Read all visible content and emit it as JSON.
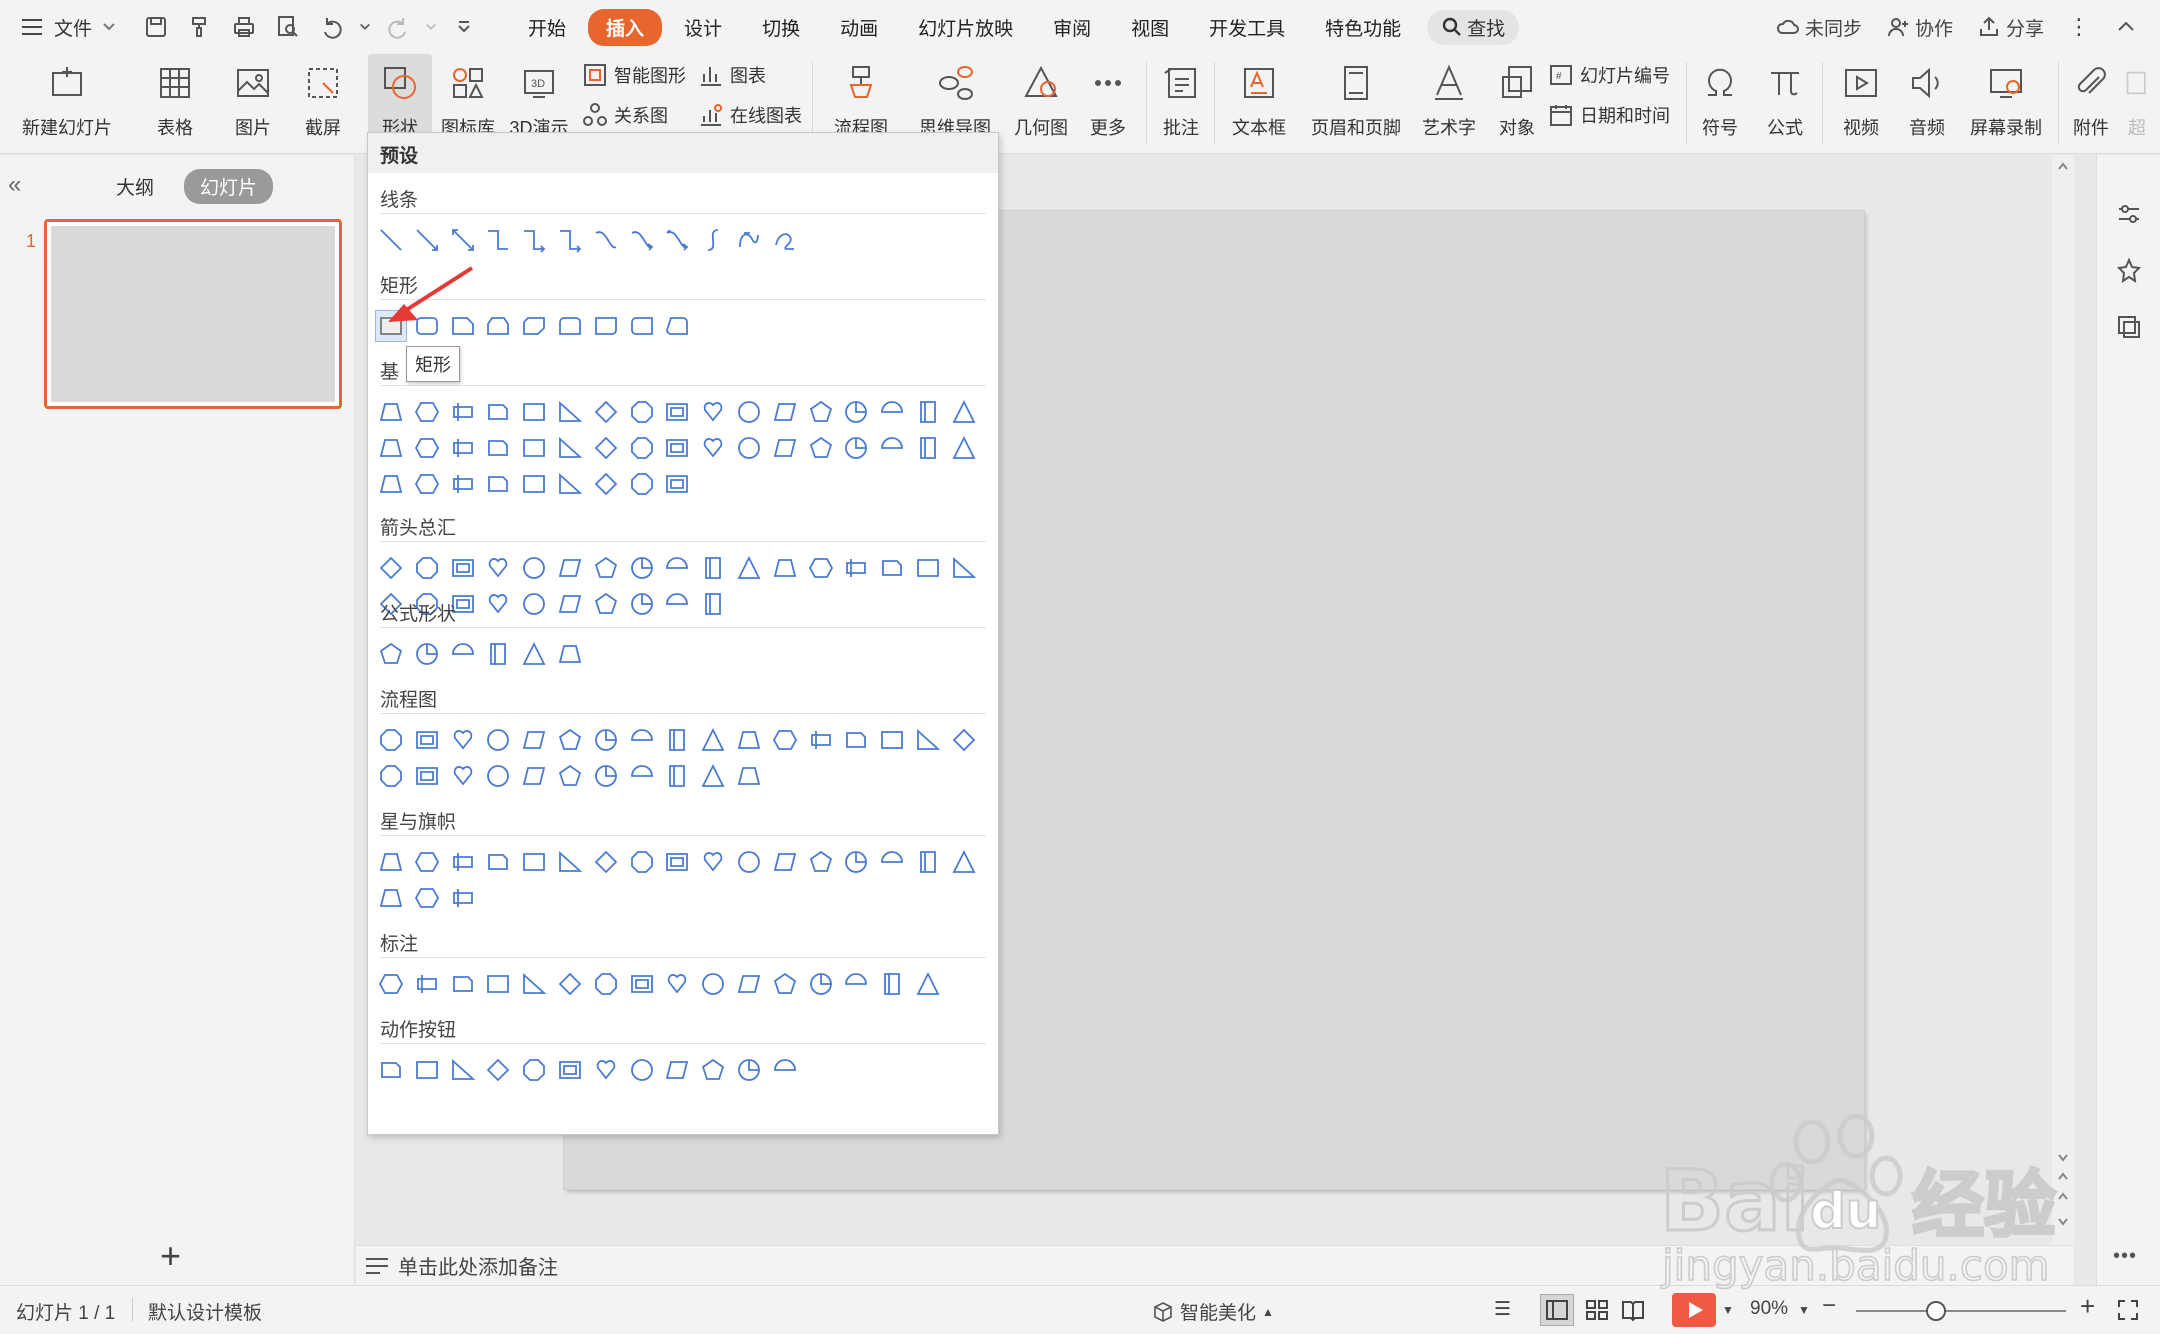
{
  "menubar": {
    "file_label": "文件",
    "tabs": [
      {
        "label": "开始",
        "active": false
      },
      {
        "label": "插入",
        "active": true
      },
      {
        "label": "设计",
        "active": false
      },
      {
        "label": "切换",
        "active": false
      },
      {
        "label": "动画",
        "active": false
      },
      {
        "label": "幻灯片放映",
        "active": false
      },
      {
        "label": "审阅",
        "active": false
      },
      {
        "label": "视图",
        "active": false
      },
      {
        "label": "开发工具",
        "active": false
      },
      {
        "label": "特色功能",
        "active": false
      }
    ],
    "search_label": "查找",
    "sync_label": "未同步",
    "collab_label": "协作",
    "share_label": "分享",
    "accent_color": "#e8662d"
  },
  "ribbon": {
    "new_slide": "新建幻灯片",
    "table": "表格",
    "picture": "图片",
    "screenshot": "截屏",
    "shape": "形状",
    "icon_lib": "图标库",
    "demo_3d": "3D演示",
    "smart_shape": "智能图形",
    "chart": "图表",
    "relation": "关系图",
    "online_chart": "在线图表",
    "flowchart": "流程图",
    "mindmap": "思维导图",
    "geometry": "几何图",
    "more": "更多",
    "comment": "批注",
    "textbox": "文本框",
    "header_footer": "页眉和页脚",
    "wordart": "艺术字",
    "object": "对象",
    "slide_number": "幻灯片编号",
    "date_time": "日期和时间",
    "symbol": "符号",
    "formula": "公式",
    "video": "视频",
    "audio": "音频",
    "screen_record": "屏幕录制",
    "attachment": "附件",
    "overflow": "超"
  },
  "left_panel": {
    "tabs": [
      {
        "label": "大纲",
        "active": false
      },
      {
        "label": "幻灯片",
        "active": true
      }
    ],
    "slide_number": "1"
  },
  "shapes_panel": {
    "header": "预设",
    "sections": [
      {
        "title": "线条"
      },
      {
        "title": "矩形"
      },
      {
        "title": "基"
      },
      {
        "title": "箭头总汇"
      },
      {
        "title": "公式形状"
      },
      {
        "title": "流程图"
      },
      {
        "title": "星与旗帜"
      },
      {
        "title": "标注"
      },
      {
        "title": "动作按钮"
      }
    ],
    "tooltip": "矩形",
    "icon_color": "#4a7bd0"
  },
  "notes": {
    "placeholder": "单击此处添加备注"
  },
  "statusbar": {
    "slide_count": "幻灯片 1 / 1",
    "template": "默认设计模板",
    "smart_beautify": "智能美化",
    "zoom": "90%",
    "zoom_level": 0.38
  },
  "watermark": {
    "text_1": "Bai",
    "text_2": "du",
    "text_3": "经验",
    "url": "jingyan.baidu.com"
  }
}
